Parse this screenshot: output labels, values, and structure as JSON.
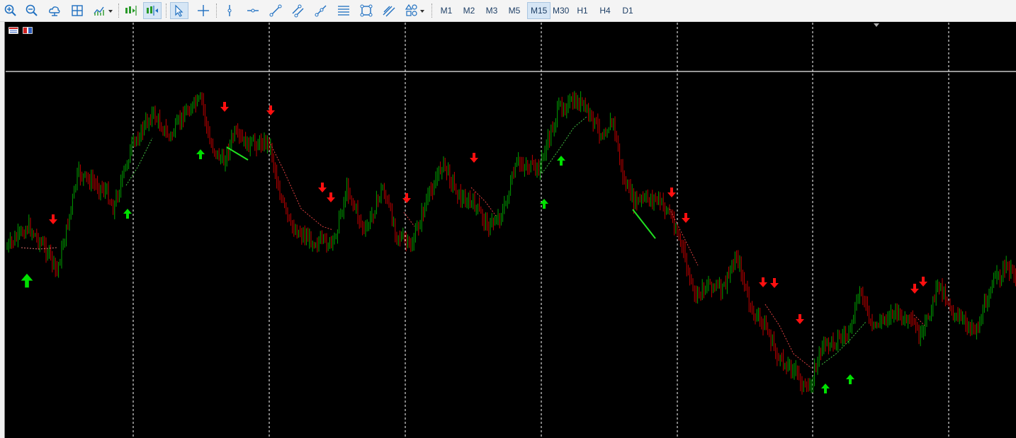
{
  "toolbar": {
    "tools": [
      {
        "name": "zoom-in-icon"
      },
      {
        "name": "zoom-out-icon"
      },
      {
        "name": "cloud-icon"
      },
      {
        "name": "grid-icon"
      },
      {
        "name": "chart-type-icon"
      },
      {
        "name": "autoscroll-icon"
      },
      {
        "name": "chart-shift-icon"
      },
      {
        "name": "cursor-icon"
      },
      {
        "name": "crosshair-icon"
      },
      {
        "name": "vertical-line-icon"
      },
      {
        "name": "horizontal-line-icon"
      },
      {
        "name": "trendline-icon"
      },
      {
        "name": "channel-icon"
      },
      {
        "name": "ray-icon"
      },
      {
        "name": "fibonacci-icon"
      },
      {
        "name": "rectangle-icon"
      },
      {
        "name": "pitchfork-icon"
      },
      {
        "name": "shapes-icon"
      }
    ],
    "timeframes": [
      "M1",
      "M2",
      "M3",
      "M5",
      "M15",
      "M30",
      "H1",
      "H4",
      "D1"
    ],
    "active_timeframe": "M15"
  },
  "chart": {
    "background": "#000000",
    "up_candle_color": "#00a000",
    "down_candle_color": "#c00000",
    "buy_arrow_color": "#00e000",
    "sell_arrow_color": "#ff1010",
    "separator_color": "#ffffff"
  }
}
